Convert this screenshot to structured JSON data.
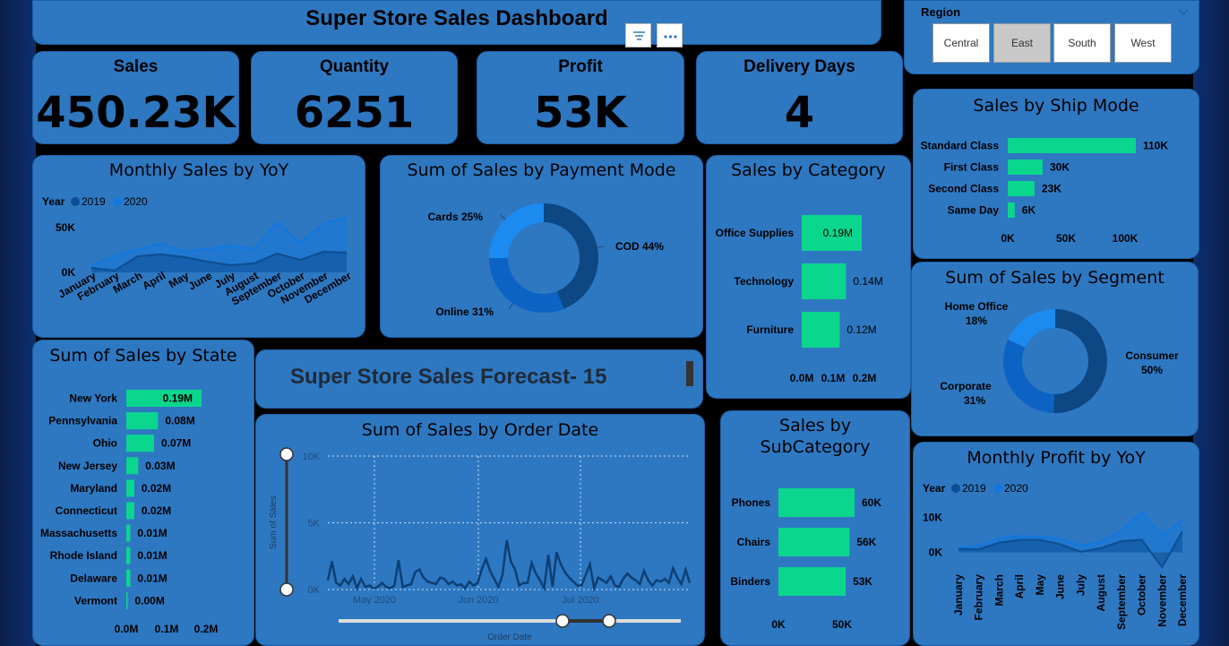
{
  "dashboard_title": "Super Store Sales Dashboard",
  "forecast_title": "Super Store Sales Forecast- 15",
  "toolbar": {
    "filter_icon": "filter-icon",
    "more_icon": "more-options-icon"
  },
  "region_slicer": {
    "title": "Region",
    "options": [
      "Central",
      "East",
      "South",
      "West"
    ],
    "selected": "East"
  },
  "kpis": [
    {
      "label": "Sales",
      "value": "450.23K"
    },
    {
      "label": "Quantity",
      "value": "6251"
    },
    {
      "label": "Profit",
      "value": "53K"
    },
    {
      "label": "Delivery Days",
      "value": "4"
    }
  ],
  "colors": {
    "card": "#2e78c2",
    "bar": "#0bd68e",
    "series2019": "#0d4f94",
    "series2020": "#1277de",
    "donut_dark": "#0d4784",
    "donut_mid": "#0c63c4",
    "donut_light": "#1b8bf2"
  },
  "chart_data": [
    {
      "id": "monthly_sales_yoy",
      "type": "area",
      "title": "Monthly Sales by YoY",
      "legend_title": "Year",
      "categories": [
        "January",
        "February",
        "March",
        "April",
        "May",
        "June",
        "July",
        "August",
        "September",
        "October",
        "November",
        "December"
      ],
      "series": [
        {
          "name": "2019",
          "values": [
            5000,
            2000,
            18000,
            20000,
            17000,
            12000,
            8000,
            10000,
            21000,
            14000,
            23000,
            22000
          ]
        },
        {
          "name": "2020",
          "values": [
            8000,
            18000,
            26000,
            32000,
            23000,
            26000,
            30000,
            26000,
            56000,
            33000,
            54000,
            62000
          ]
        }
      ],
      "yticks": [
        "0K",
        "50K"
      ],
      "ylim": [
        0,
        70000
      ]
    },
    {
      "id": "sales_by_payment_mode",
      "type": "pie",
      "title": "Sum of Sales by Payment Mode",
      "labels": [
        "COD 44%",
        "Online 31%",
        "Cards 25%"
      ],
      "values": [
        44,
        31,
        25
      ]
    },
    {
      "id": "sales_by_category",
      "type": "bar",
      "title": "Sales by Category",
      "categories": [
        "Office Supplies",
        "Technology",
        "Furniture"
      ],
      "values": [
        0.19,
        0.14,
        0.12
      ],
      "data_labels": [
        "0.19M",
        "0.14M",
        "0.12M"
      ],
      "xticks": [
        "0.0M",
        "0.1M",
        "0.2M"
      ],
      "xlim": [
        0,
        0.2
      ]
    },
    {
      "id": "sales_by_ship_mode",
      "type": "bar",
      "title": "Sales by Ship Mode",
      "categories": [
        "Standard Class",
        "First Class",
        "Second Class",
        "Same Day"
      ],
      "values": [
        110,
        30,
        23,
        6
      ],
      "data_labels": [
        "110K",
        "30K",
        "23K",
        "6K"
      ],
      "xticks": [
        "0K",
        "50K",
        "100K"
      ],
      "xlim": [
        0,
        100
      ]
    },
    {
      "id": "sales_by_segment",
      "type": "pie",
      "title": "Sum of Sales by Segment",
      "labels": [
        "Consumer 50%",
        "Corporate 31%",
        "Home Office 18%"
      ],
      "names": [
        "Consumer",
        "Corporate",
        "Home Office"
      ],
      "pcts": [
        "50%",
        "31%",
        "18%"
      ],
      "values": [
        50,
        31,
        18
      ]
    },
    {
      "id": "sales_by_state",
      "type": "bar",
      "title": "Sum of Sales by State",
      "categories": [
        "New York",
        "Pennsylvania",
        "Ohio",
        "New Jersey",
        "Maryland",
        "Connecticut",
        "Massachusetts",
        "Rhode Island",
        "Delaware",
        "Vermont"
      ],
      "values": [
        0.19,
        0.08,
        0.07,
        0.03,
        0.02,
        0.02,
        0.01,
        0.01,
        0.01,
        0.0
      ],
      "data_labels": [
        "0.19M",
        "0.08M",
        "0.07M",
        "0.03M",
        "0.02M",
        "0.02M",
        "0.01M",
        "0.01M",
        "0.01M",
        "0.00M"
      ],
      "xticks": [
        "0.0M",
        "0.1M",
        "0.2M"
      ],
      "xlim": [
        0,
        0.2
      ]
    },
    {
      "id": "sales_by_order_date",
      "type": "line",
      "title": "Sum of Sales by Order Date",
      "xlabel": "Order Date",
      "ylabel": "Sum of Sales",
      "xticks": [
        "May 2020",
        "Jun 2020",
        "Jul 2020"
      ],
      "yticks": [
        "0K",
        "5K",
        "10K"
      ],
      "ylim": [
        0,
        10000
      ],
      "values": [
        700,
        2100,
        500,
        300,
        800,
        400,
        1000,
        100,
        800,
        200,
        300,
        100,
        200,
        500,
        200,
        100,
        300,
        2200,
        200,
        300,
        400,
        1300,
        1500,
        900,
        600,
        500,
        400,
        900,
        800,
        400,
        600,
        300,
        400,
        100,
        600,
        300,
        500,
        1500,
        2300,
        1400,
        800,
        200,
        1100,
        3700,
        2100,
        1500,
        300,
        500,
        500,
        2000,
        1200,
        700,
        100,
        2600,
        200,
        2800,
        1900,
        1300,
        900,
        600,
        300,
        300,
        1100,
        1900,
        100,
        900,
        700,
        500,
        1000,
        300,
        200,
        800,
        1200,
        900,
        700,
        400,
        1400,
        700,
        300,
        700,
        600,
        800,
        500,
        1600,
        900,
        400,
        1500,
        500
      ]
    },
    {
      "id": "sales_by_subcategory",
      "type": "bar",
      "title": "Sales by SubCategory",
      "title_lines": [
        "Sales by",
        "SubCategory"
      ],
      "categories": [
        "Phones",
        "Chairs",
        "Binders"
      ],
      "values": [
        60,
        56,
        53
      ],
      "data_labels": [
        "60K",
        "56K",
        "53K"
      ],
      "xticks": [
        "0K",
        "50K"
      ],
      "xlim": [
        0,
        50
      ]
    },
    {
      "id": "monthly_profit_yoy",
      "type": "area",
      "title": "Monthly Profit by YoY",
      "legend_title": "Year",
      "categories": [
        "January",
        "February",
        "March",
        "April",
        "May",
        "June",
        "July",
        "August",
        "September",
        "October",
        "November",
        "December"
      ],
      "series": [
        {
          "name": "2019",
          "values": [
            1000,
            900,
            2800,
            3600,
            3600,
            2300,
            200,
            1200,
            3200,
            3600,
            -4200,
            6000
          ]
        },
        {
          "name": "2020",
          "values": [
            1400,
            1800,
            4000,
            4700,
            4400,
            4000,
            1800,
            3000,
            6300,
            11500,
            5000,
            9200
          ]
        }
      ],
      "yticks": [
        "0K",
        "10K"
      ],
      "ylim": [
        -5000,
        13000
      ]
    }
  ]
}
